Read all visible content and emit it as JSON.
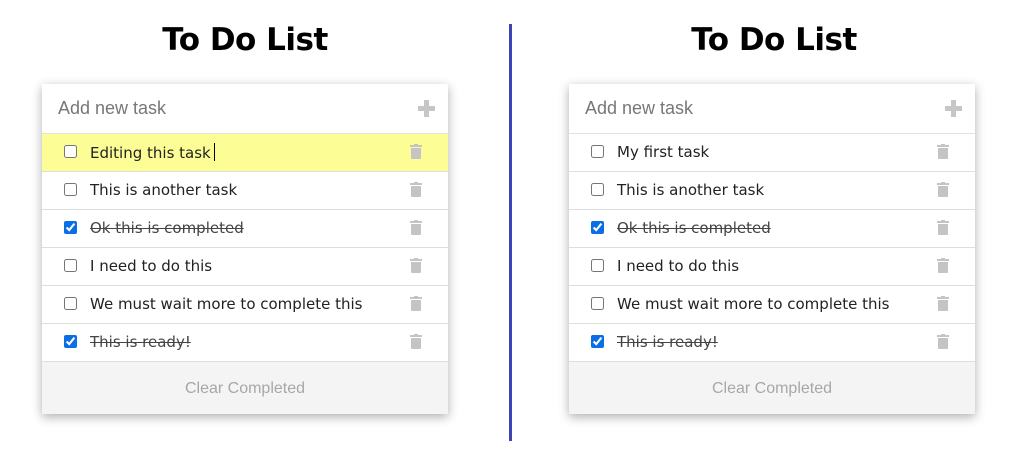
{
  "panels": [
    {
      "title": "To Do List",
      "add_placeholder": "Add new task",
      "clear_label": "Clear Completed",
      "tasks": [
        {
          "text": "Editing this task",
          "completed": false,
          "editing": true
        },
        {
          "text": "This is another task",
          "completed": false,
          "editing": false
        },
        {
          "text": "Ok this is completed",
          "completed": true,
          "editing": false
        },
        {
          "text": "I need to do this",
          "completed": false,
          "editing": false
        },
        {
          "text": "We must wait more to complete this",
          "completed": false,
          "editing": false
        },
        {
          "text": "This is ready!",
          "completed": true,
          "editing": false
        }
      ]
    },
    {
      "title": "To Do List",
      "add_placeholder": "Add new task",
      "clear_label": "Clear Completed",
      "tasks": [
        {
          "text": "My first task",
          "completed": false,
          "editing": false
        },
        {
          "text": "This is another task",
          "completed": false,
          "editing": false
        },
        {
          "text": "Ok this is completed",
          "completed": true,
          "editing": false
        },
        {
          "text": "I need to do this",
          "completed": false,
          "editing": false
        },
        {
          "text": "We must wait more to complete this",
          "completed": false,
          "editing": false
        },
        {
          "text": "This is ready!",
          "completed": true,
          "editing": false
        }
      ]
    }
  ],
  "colors": {
    "divider": "#3e44b6",
    "editing_highlight": "#fdfd96",
    "checkbox_accent": "#0a6fe5"
  },
  "icons": {
    "add": "plus-icon",
    "delete": "trash-icon"
  }
}
